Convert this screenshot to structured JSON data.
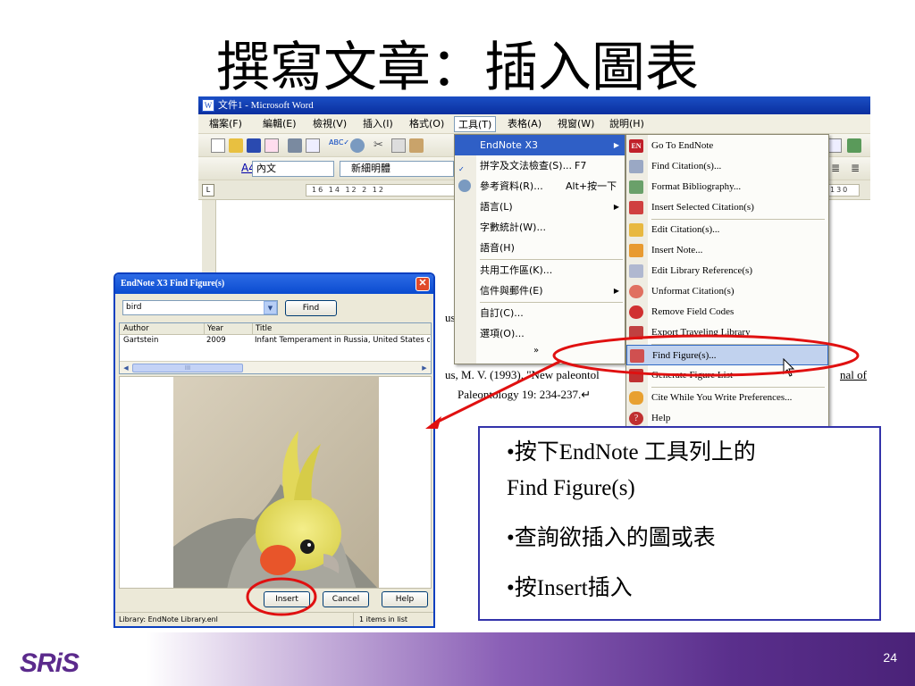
{
  "slide": {
    "title": "撰寫文章：插入圖表",
    "page_number": "24",
    "logo_text": "SRiS"
  },
  "word": {
    "window_title": "文件1 - Microsoft Word",
    "menus": [
      "檔案(F)",
      "編輯(E)",
      "檢視(V)",
      "插入(I)",
      "格式(O)",
      "工具(T)",
      "表格(A)",
      "視窗(W)",
      "說明(H)"
    ],
    "active_menu": "工具(T)",
    "style_a4": "A4",
    "style_value": "內文",
    "font_value": "新細明體",
    "ruler_text": "16  14  12  2  12",
    "ruler_right": "130",
    "doc": {
      "fragment_us": "us",
      "citation_line": "us, M. V. (1993). \"New paleontol",
      "journal_fragment": "nal of",
      "citation_line2": "Paleontology 19: 234-237.↵"
    }
  },
  "tools_menu": {
    "items": [
      {
        "label": "EndNote X3",
        "shortcut": "",
        "submenu": true
      },
      {
        "label": "拼字及文法檢查(S)...",
        "shortcut": "F7",
        "submenu": false
      },
      {
        "label": "參考資料(R)...",
        "shortcut": "Alt+按一下",
        "submenu": false
      },
      {
        "label": "語言(L)",
        "shortcut": "",
        "submenu": true
      },
      {
        "label": "字數統計(W)...",
        "shortcut": "",
        "submenu": false
      },
      {
        "label": "語音(H)",
        "shortcut": "",
        "submenu": false
      },
      {
        "label": "共用工作區(K)...",
        "shortcut": "",
        "submenu": false
      },
      {
        "label": "信件與郵件(E)",
        "shortcut": "",
        "submenu": true
      },
      {
        "label": "自訂(C)...",
        "shortcut": "",
        "submenu": false
      },
      {
        "label": "選項(O)...",
        "shortcut": "",
        "submenu": false
      }
    ],
    "more_glyph": "»"
  },
  "endnote_menu": {
    "items": [
      {
        "label": "Go To EndNote",
        "icon": "endnote-logo-icon"
      },
      {
        "label": "Find Citation(s)...",
        "icon": "find-citation-icon"
      },
      {
        "label": "Format Bibliography...",
        "icon": "format-bibliography-icon"
      },
      {
        "label": "Insert Selected Citation(s)",
        "icon": "insert-citation-icon"
      },
      {
        "label": "Edit Citation(s)...",
        "icon": "edit-citation-icon"
      },
      {
        "label": "Insert Note...",
        "icon": "insert-note-icon"
      },
      {
        "label": "Edit Library Reference(s)",
        "icon": "edit-library-icon"
      },
      {
        "label": "Unformat Citation(s)",
        "icon": "unformat-icon"
      },
      {
        "label": "Remove Field Codes",
        "icon": "remove-field-codes-icon"
      },
      {
        "label": "Export Traveling Library",
        "icon": "export-library-icon"
      },
      {
        "label": "Find Figure(s)...",
        "icon": "find-figure-icon"
      },
      {
        "label": "Generate Figure List",
        "icon": "generate-figure-list-icon"
      },
      {
        "label": "Cite While You Write Preferences...",
        "icon": "preferences-icon"
      },
      {
        "label": "Help",
        "icon": "help-icon"
      }
    ],
    "highlighted": "Find Figure(s)..."
  },
  "find_figure": {
    "title": "EndNote X3 Find Figure(s)",
    "search_value": "bird",
    "find_label": "Find",
    "columns": [
      "Author",
      "Year",
      "Title"
    ],
    "rows": [
      {
        "author": "Gartstein",
        "year": "2009",
        "title": "Infant Temperament in Russia, United States of Amer"
      }
    ],
    "scroll_thumb": "III",
    "insert_label": "Insert",
    "cancel_label": "Cancel",
    "help_label": "Help",
    "status_left": "Library: EndNote Library.enl",
    "status_right": "1 items in list"
  },
  "info_box": {
    "lines": [
      "•按下EndNote 工具列上的",
      "Find Figure(s)",
      "•查詢欲插入的圖或表",
      "•按Insert插入"
    ]
  },
  "colors": {
    "title_bar": "#0a2f9f",
    "menu_highlight": "#2f5fc6",
    "annotation_red": "#e01010",
    "info_border": "#3333aa",
    "footer_purple": "#5a2f8c"
  }
}
